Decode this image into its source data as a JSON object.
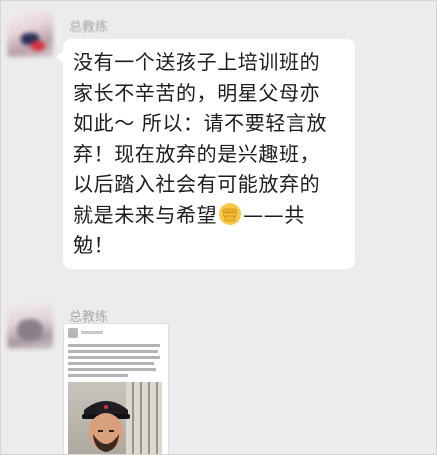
{
  "messages": [
    {
      "sender": "总教练",
      "lines": [
        "没有一个送孩子上培训班的",
        "家长不辛苦的，明星父母亦",
        "如此～ 所以：请不要轻言放",
        "弃！现在放弃的是兴趣班，",
        "以后踏入社会有可能放弃的"
      ],
      "last_line_before_emoji": "就是未来与希望",
      "emoji": "fist-emoji",
      "last_line_after_emoji": "——共",
      "final_line": "勉！"
    },
    {
      "sender": "总教练",
      "attachment": "shared-post-screenshot"
    }
  ],
  "colors": {
    "background": "#ececec",
    "bubble": "#ffffff",
    "sender_text": "#a8a8a8",
    "message_text": "#1c1c1c"
  }
}
